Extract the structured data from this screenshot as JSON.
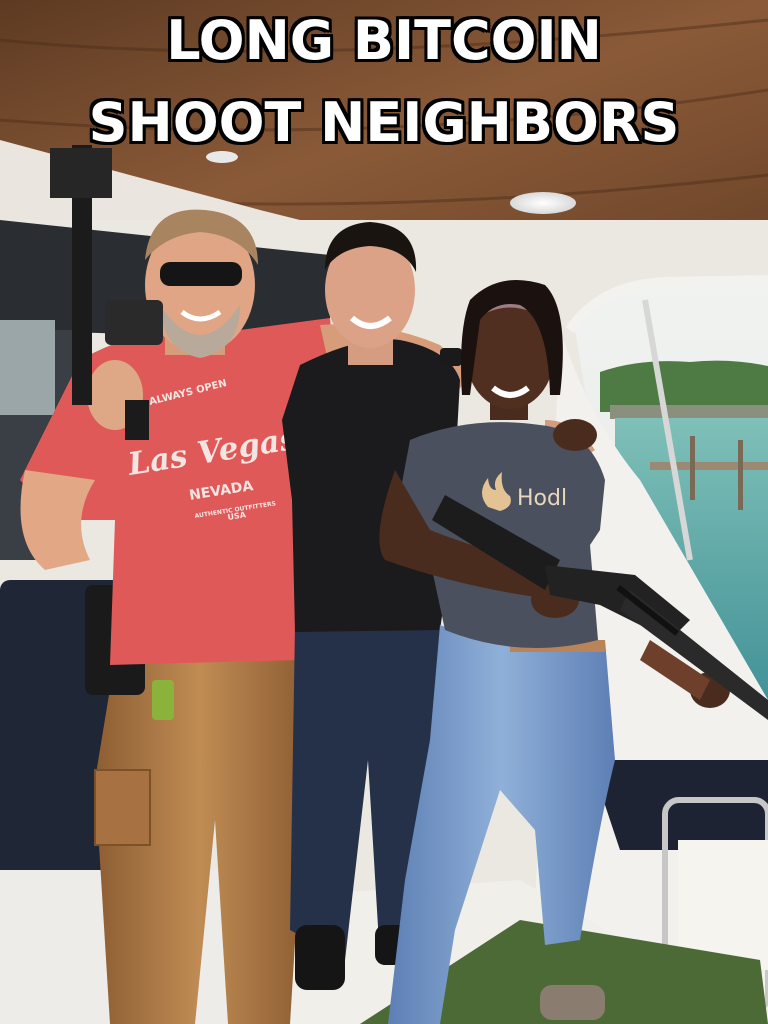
{
  "meme": {
    "caption_line_1": "LONG BITCOIN",
    "caption_line_2": "SHOOT NEIGHBORS"
  },
  "shirt_red": {
    "line_arc": "ALWAYS OPEN",
    "city": "Las Vegas",
    "state": "NEVADA",
    "small": "AUTHENTIC OUTFITTERS",
    "country": "USA"
  },
  "shirt_grey": {
    "logo_text": "Hodl"
  },
  "colors": {
    "red_shirt": "#e05555",
    "black_shirt": "#1d1d1f",
    "grey_shirt": "#4a4f5c",
    "khaki_pants": "#b07a45",
    "jeans_dark": "#2c3a55",
    "jeans_light": "#7c9bc8",
    "wood_ceiling": "#7a4e31",
    "water": "#5fa9a6"
  }
}
